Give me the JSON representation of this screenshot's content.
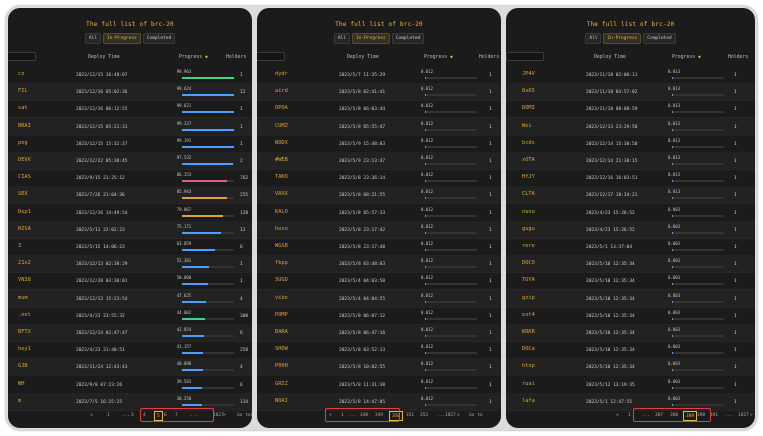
{
  "panels": [
    {
      "title": "The full list of brc-20",
      "tabs": [
        "All",
        "In-Progress",
        "Completed"
      ],
      "columns": {
        "time": "Deploy Time",
        "progress": "Progress",
        "holders": "Holders",
        "progress_icon": "sort-icon"
      },
      "rows": [
        [
          "cz",
          "2023/12/15 16:48:07",
          "99.963",
          "1",
          0.9996,
          "#3fd38a"
        ],
        [
          "FIL",
          "2023/12/16 05:02:36",
          "99.624",
          "12",
          0.996,
          "#4aa0ff"
        ],
        [
          "sat",
          "2023/12/16 06:12:55",
          "99.621",
          "1",
          0.996,
          "#4aa0ff"
        ],
        [
          "BRAI",
          "2023/12/15 05:21:31",
          "99.337",
          "1",
          0.993,
          "#4aa0ff"
        ],
        [
          "png",
          "2023/12/15 15:32:37",
          "99.191",
          "1",
          0.992,
          "#4aa0ff"
        ],
        [
          "DEVV",
          "2023/12/22 05:38:45",
          "97.532",
          "2",
          0.975,
          "#4aa0ff"
        ],
        [
          "CIAS",
          "2023/9/15 21:25:12",
          "86.153",
          "762",
          0.86,
          "#e05a8a"
        ],
        [
          "SEX",
          "2023/7/26 21:04:36",
          "85.943",
          "255",
          0.86,
          "#e0a33a"
        ],
        [
          "Dep1",
          "2023/12/16 14:49:54",
          "79.067",
          "128",
          0.79,
          "#e0a33a"
        ],
        [
          "H2SA",
          "2023/5/11 22:02:23",
          "75.171",
          "12",
          0.75,
          "#4aa0ff"
        ],
        [
          "3",
          "2023/5/15 14:06:23",
          "63.059",
          "6",
          0.63,
          "#4aa0ff"
        ],
        [
          "21x2",
          "2023/12/13 02:38:29",
          "52.381",
          "1",
          0.52,
          "#4aa0ff"
        ],
        [
          "VN38",
          "2023/12/20 03:30:01",
          "50.000",
          "1",
          0.5,
          "#4aa0ff"
        ],
        [
          "mum",
          "2023/12/12 15:23:54",
          "47.625",
          "4",
          0.47,
          "#4aa0ff"
        ],
        [
          ".net",
          "2023/4/23 23:55:32",
          "44.002",
          "300",
          0.44,
          "#3fd38a"
        ],
        [
          "BFTX",
          "2023/12/14 02:47:47",
          "42.854",
          "6",
          0.42,
          "#4aa0ff"
        ],
        [
          "hey1",
          "2023/4/23 21:40:51",
          "41.157",
          "258",
          0.41,
          "#4aa0ff"
        ],
        [
          "GJB",
          "2023/11/24 12:43:43",
          "40.090",
          "4",
          0.4,
          "#4aa0ff"
        ],
        [
          "NH",
          "2023/9/8 07:23:26",
          "39.583",
          "6",
          0.39,
          "#4aa0ff"
        ],
        [
          "m",
          "2023/7/5 16:25:25",
          "38.250",
          "134",
          0.38,
          "#4aa0ff"
        ]
      ],
      "pager": {
        "items": [
          "<",
          "1",
          "...",
          "3",
          "4",
          "5",
          "6",
          "7",
          "...",
          "1827",
          ">",
          "Go to",
          "Page"
        ],
        "current": "5"
      }
    },
    {
      "title": "The full list of brc-20",
      "tabs": [
        "All",
        "In-Progress",
        "Completed"
      ],
      "columns": {
        "time": "Deploy Time",
        "progress": "Progress",
        "holders": "Holders",
        "progress_icon": "sort-icon"
      },
      "rows": [
        [
          "dydr",
          "2023/5/7 11:35:29",
          "0.012",
          "1",
          0.012,
          "#4aa0ff"
        ],
        [
          "aird",
          "2023/5/8 02:41:41",
          "0.012",
          "1",
          0.012,
          "#4aa0ff"
        ],
        [
          "OPOA",
          "2023/5/8 06:03:44",
          "0.012",
          "1",
          0.012,
          "#4aa0ff"
        ],
        [
          "CUMZ",
          "2023/5/8 05:55:47",
          "0.012",
          "1",
          0.012,
          "#4aa0ff"
        ],
        [
          "NODX",
          "2023/5/9 15:48:03",
          "0.012",
          "1",
          0.012,
          "#4aa0ff"
        ],
        [
          "#WEB",
          "2023/5/9 23:13:47",
          "0.012",
          "1",
          0.012,
          "#4aa0ff"
        ],
        [
          "TAKO",
          "2023/5/8 23:36:14",
          "0.012",
          "1",
          0.012,
          "#4aa0ff"
        ],
        [
          "VAXX",
          "2023/5/8 08:21:55",
          "0.012",
          "1",
          0.012,
          "#4aa0ff"
        ],
        [
          "KALO",
          "2023/5/8 05:57:33",
          "0.012",
          "1",
          0.012,
          "#4aa0ff"
        ],
        [
          "huso",
          "2023/5/8 23:17:42",
          "0.012",
          "1",
          0.012,
          "#4aa0ff"
        ],
        [
          "WGSB",
          "2023/5/8 23:17:48",
          "0.012",
          "1",
          0.012,
          "#4aa0ff"
        ],
        [
          "fkpp",
          "2023/5/8 03:48:03",
          "0.012",
          "1",
          0.012,
          "#4aa0ff"
        ],
        [
          "SUGD",
          "2023/5/4 04:03:50",
          "0.012",
          "1",
          0.012,
          "#4aa0ff"
        ],
        [
          "vibe",
          "2023/5/4 04:04:55",
          "0.012",
          "1",
          0.012,
          "#4aa0ff"
        ],
        [
          "POMP",
          "2023/5/8 06:07:12",
          "0.012",
          "1",
          0.012,
          "#4aa0ff"
        ],
        [
          "BARA",
          "2023/5/8 06:47:16",
          "0.012",
          "1",
          0.012,
          "#4aa0ff"
        ],
        [
          "SHOW",
          "2023/5/8 03:52:13",
          "0.012",
          "1",
          0.012,
          "#4aa0ff"
        ],
        [
          "P00H",
          "2023/5/8 10:02:55",
          "0.012",
          "1",
          0.012,
          "#4aa0ff"
        ],
        [
          "GRIZ",
          "2023/5/8 11:31:38",
          "0.012",
          "1",
          0.012,
          "#4aa0ff"
        ],
        [
          "NOAI",
          "2023/5/8 14:47:05",
          "0.012",
          "1",
          0.012,
          "#4aa0ff"
        ]
      ],
      "pager": {
        "items": [
          "<",
          "1",
          "...",
          "348",
          "349",
          "350",
          "351",
          "352",
          "...",
          "1827",
          ">",
          "Go to"
        ],
        "current": "350"
      }
    },
    {
      "title": "The full list of brc-20",
      "tabs": [
        "All",
        "In-Progress",
        "Completed"
      ],
      "columns": {
        "time": "Deploy Time",
        "progress": "Progress",
        "holders": "Holders",
        "progress_icon": "sort-icon"
      },
      "rows": [
        [
          "JP4V",
          "2023/11/18 02:06:11",
          "0.013",
          "1",
          0.013,
          "#4aa0ff"
        ],
        [
          "8x65",
          "2023/11/18 03:57:02",
          "0.013",
          "1",
          0.013,
          "#4aa0ff"
        ],
        [
          "DOMI",
          "2023/11/18 08:08:59",
          "0.013",
          "1",
          0.013,
          "#4aa0ff"
        ],
        [
          "Wei",
          "2023/12/13 23:29:58",
          "0.013",
          "1",
          0.013,
          "#4aa0ff"
        ],
        [
          "bcds",
          "2023/12/14 15:30:50",
          "0.013",
          "1",
          0.013,
          "#4aa0ff"
        ],
        [
          "xOTA",
          "2023/12/14 21:38:15",
          "0.013",
          "1",
          0.013,
          "#4aa0ff"
        ],
        [
          "HYJY",
          "2023/12/16 16:03:51",
          "0.013",
          "1",
          0.013,
          "#4aa0ff"
        ],
        [
          "CLTA",
          "2023/12/17 18:34:21",
          "0.013",
          "1",
          0.013,
          "#4aa0ff"
        ],
        [
          "nunu",
          "2023/4/23 15:26:52",
          "0.003",
          "1",
          0.003,
          "#4aa0ff"
        ],
        [
          "gugu",
          "2023/4/23 15:26:52",
          "0.003",
          "1",
          0.003,
          "#4aa0ff"
        ],
        [
          "rere",
          "2023/5/1 13:37:04",
          "0.003",
          "1",
          0.003,
          "#4aa0ff"
        ],
        [
          "DOCO",
          "2023/5/10 12:35:34",
          "0.003",
          "1",
          0.003,
          "#4aa0ff"
        ],
        [
          "TUYA",
          "2023/5/10 12:35:34",
          "0.003",
          "1",
          0.003,
          "#4aa0ff"
        ],
        [
          "gzip",
          "2023/5/10 12:35:34",
          "0.003",
          "1",
          0.003,
          "#4aa0ff"
        ],
        [
          "ext4",
          "2023/5/10 12:35:34",
          "0.003",
          "1",
          0.003,
          "#4aa0ff"
        ],
        [
          "KRKR",
          "2023/5/10 12:35:34",
          "0.003",
          "1",
          0.003,
          "#4aa0ff"
        ],
        [
          "DOCa",
          "2023/5/10 12:35:34",
          "0.003",
          "1",
          0.003,
          "#4aa0ff"
        ],
        [
          "htop",
          "2023/5/10 12:35:34",
          "0.003",
          "1",
          0.003,
          "#4aa0ff"
        ],
        [
          "ruai",
          "2023/5/12 13:19:35",
          "0.003",
          "1",
          0.003,
          "#4aa0ff"
        ],
        [
          "lafa",
          "2023/5/1 12:47:55",
          "0.003",
          "1",
          0.003,
          "#4aa0ff"
        ]
      ],
      "pager": {
        "items": [
          "<",
          "1",
          "...",
          "387",
          "388",
          "389",
          "390",
          "391",
          "...",
          "1827",
          ">",
          "Go to"
        ],
        "current": "389"
      }
    }
  ],
  "colors": {
    "accent": "#e8b84a",
    "highlight": "#e04040"
  }
}
